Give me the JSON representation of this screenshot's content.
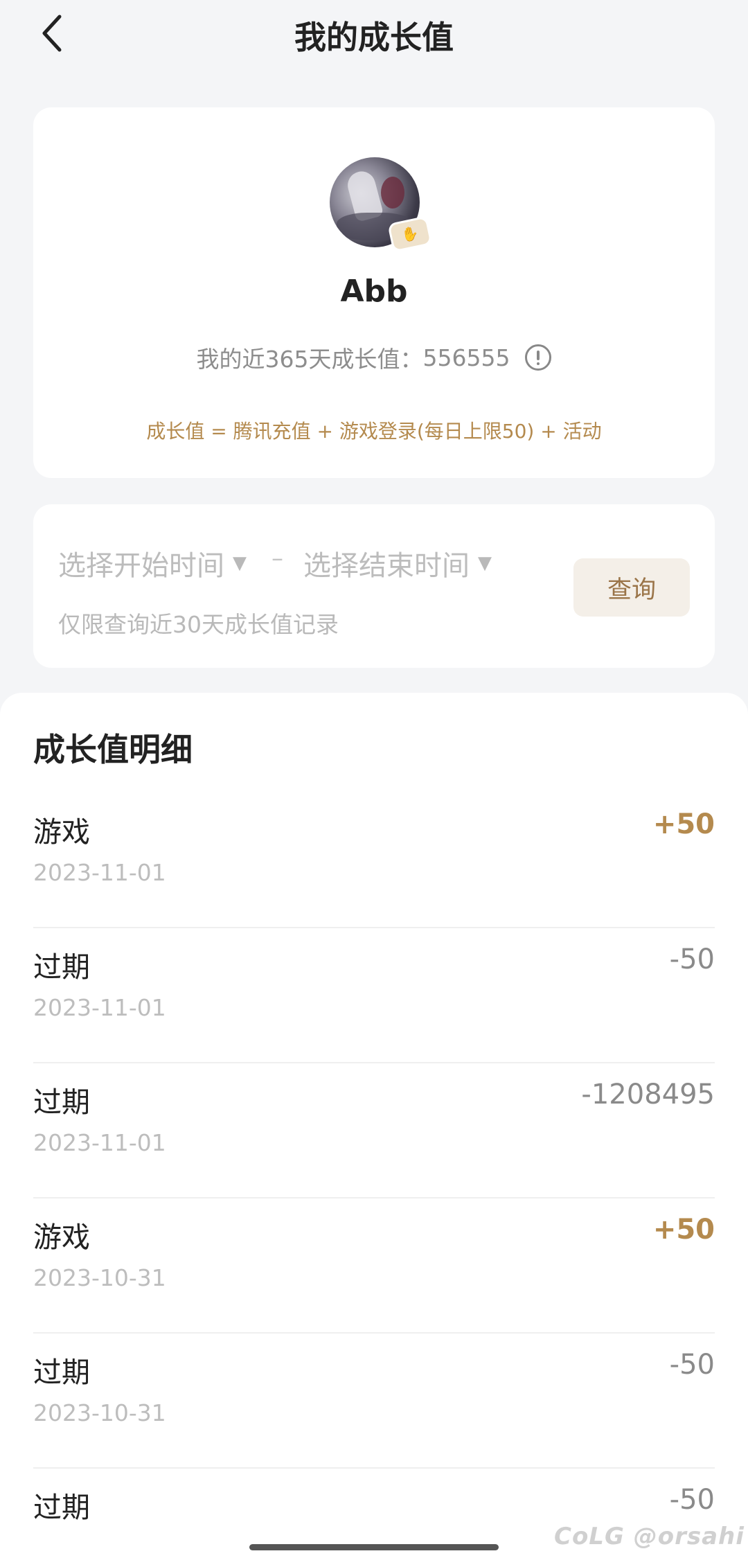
{
  "header": {
    "title": "我的成长值"
  },
  "profile": {
    "username": "Abb",
    "growth_label": "我的近365天成长值：",
    "growth_value": "556555",
    "formula": "成长值 = 腾讯充值 + 游戏登录(每日上限50) + 活动"
  },
  "query": {
    "start_placeholder": "选择开始时间",
    "end_placeholder": "选择结束时间",
    "separator": "–",
    "hint": "仅限查询近30天成长值记录",
    "button_label": "查询"
  },
  "details": {
    "title": "成长值明细",
    "records": [
      {
        "type": "游戏",
        "date": "2023-11-01",
        "amount": "+50"
      },
      {
        "type": "过期",
        "date": "2023-11-01",
        "amount": "-50"
      },
      {
        "type": "过期",
        "date": "2023-11-01",
        "amount": "-1208495"
      },
      {
        "type": "游戏",
        "date": "2023-10-31",
        "amount": "+50"
      },
      {
        "type": "过期",
        "date": "2023-10-31",
        "amount": "-50"
      },
      {
        "type": "过期",
        "date": "",
        "amount": "-50"
      }
    ]
  },
  "watermark": "CoLG @orsahi",
  "icons": {
    "back": "chevron-left-icon",
    "info": "info-icon",
    "caret": "caret-down-icon",
    "badge": "vip-badge-icon"
  },
  "colors": {
    "accent": "#b48a4e",
    "background": "#f4f5f7",
    "card": "#ffffff",
    "button_bg": "#f4efe8"
  }
}
